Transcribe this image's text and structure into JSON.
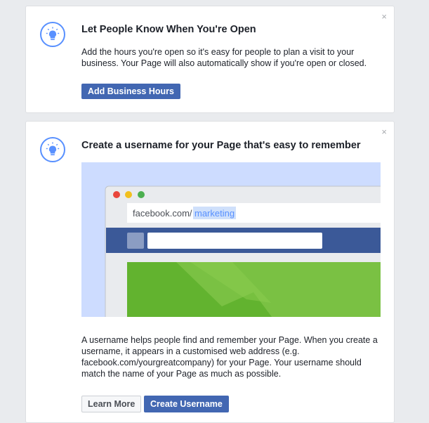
{
  "cards": [
    {
      "title": "Let People Know When You're Open",
      "body": "Add the hours you're open so it's easy for people to plan a visit to your business. Your Page will also automatically show if you're open or closed.",
      "button_label": "Add Business Hours",
      "close_glyph": "×",
      "icon": "lightbulb-icon"
    },
    {
      "title": "Create a username for your Page that's easy to remember",
      "illustration": {
        "url_prefix": "facebook.com/",
        "url_highlight": "marketing"
      },
      "body": "A username helps people find and remember your Page. When you create a username, it appears in a customised web address (e.g. facebook.com/yourgreatcompany) for your Page. Your username should match the name of your Page as much as possible.",
      "secondary_button_label": "Learn More",
      "primary_button_label": "Create Username",
      "close_glyph": "×",
      "icon": "lightbulb-icon"
    }
  ],
  "colors": {
    "accent": "#4267b2",
    "bulb": "#5890ff",
    "illustration_bg": "#cddcff",
    "browser_nav": "#3b5998",
    "green": "#7ac143"
  }
}
